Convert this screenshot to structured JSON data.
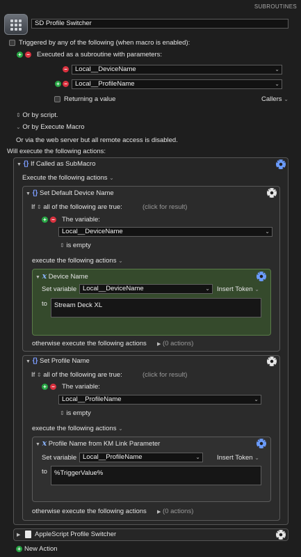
{
  "header": {
    "section": "SUBROUTINES"
  },
  "macro": {
    "name": "SD Profile Switcher"
  },
  "triggers": {
    "heading": "Triggered by any of the following (when macro is enabled):",
    "subroutine_label": "Executed as a subroutine with parameters:",
    "params": [
      "Local__DeviceName",
      "Local__ProfileName"
    ],
    "returning": "Returning a value",
    "callers": "Callers",
    "or_script": "Or by script.",
    "or_execute": "Or by Execute Macro",
    "web": "Or via the web server but all remote access is disabled."
  },
  "actions_heading": "Will execute the following actions:",
  "submacro": {
    "title": "If Called as SubMacro",
    "exec_label": "Execute the following actions",
    "block1": {
      "title": "Set Default Device Name",
      "if_prefix": "If",
      "if_cond": "all of the following are true:",
      "click": "(click for result)",
      "variable_label": "The variable:",
      "variable": "Local__DeviceName",
      "is_empty": "is empty",
      "exec": "execute the following actions",
      "action_title": "Device Name",
      "set_var": "Set variable",
      "set_var_value": "Local__DeviceName",
      "insert_token": "Insert Token",
      "to": "to",
      "to_value": "Stream Deck XL",
      "otherwise": "otherwise execute the following actions",
      "otherwise_count": "(0 actions)"
    },
    "block2": {
      "title": "Set Profile Name",
      "if_prefix": "If",
      "if_cond": "all of the following are true:",
      "click": "(click for result)",
      "variable_label": "The variable:",
      "variable": "Local__ProfileName",
      "is_empty": "is empty",
      "exec": "execute the following actions",
      "action_title": "Profile Name from KM Link Parameter",
      "set_var": "Set variable",
      "set_var_value": "Local__ProfileName",
      "insert_token": "Insert Token",
      "to": "to",
      "to_value": "%TriggerValue%",
      "otherwise": "otherwise execute the following actions",
      "otherwise_count": "(0 actions)"
    }
  },
  "applescript": {
    "title": "AppleScript Profile Switcher"
  },
  "new_action": "New Action"
}
